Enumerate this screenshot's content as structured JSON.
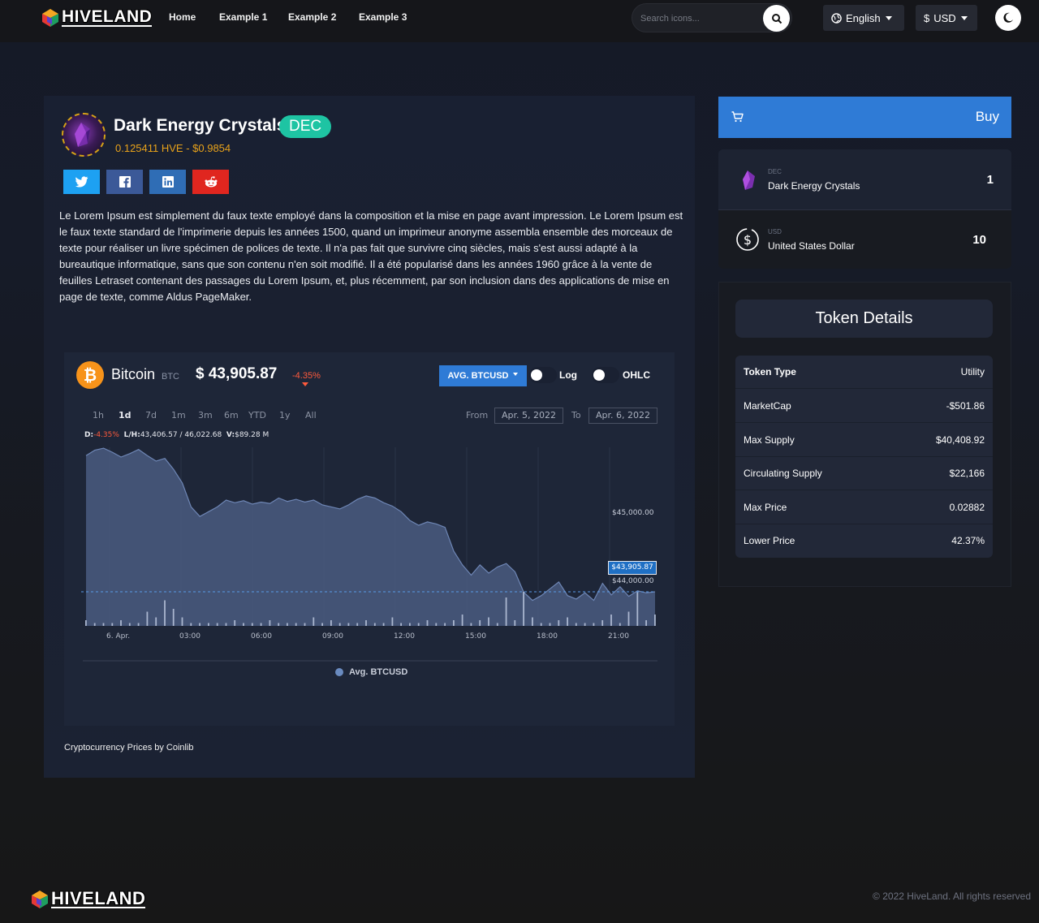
{
  "brand": {
    "name": "HIVELAND"
  },
  "nav": {
    "links": [
      "Home",
      "Example 1",
      "Example 2",
      "Example 3"
    ],
    "search_placeholder": "Search icons...",
    "language": "English",
    "currency_symbol": "$",
    "currency": "USD"
  },
  "token": {
    "name": "Dark Energy Crystals",
    "symbol": "DEC",
    "price_line": "0.125411 HVE - $0.9854",
    "description": "Le Lorem Ipsum est simplement du faux texte employé dans la composition et la mise en page avant impression. Le Lorem Ipsum est le faux texte standard de l'imprimerie depuis les années 1500, quand un imprimeur anonyme assembla ensemble des morceaux de texte pour réaliser un livre spécimen de polices de texte. Il n'a pas fait que survivre cinq siècles, mais s'est aussi adapté à la bureautique informatique, sans que son contenu n'en soit modifié. Il a été popularisé dans les années 1960 grâce à la vente de feuilles Letraset contenant des passages du Lorem Ipsum, et, plus récemment, par son inclusion dans des applications de mise en page de texte, comme Aldus PageMaker."
  },
  "share": [
    "twitter",
    "facebook",
    "linkedin",
    "reddit"
  ],
  "widget": {
    "coin_name": "Bitcoin",
    "coin_symbol": "BTC",
    "price": "$ 43,905.87",
    "change": "-4.35%",
    "series_button": "AVG. BTCUSD",
    "toggle_log": "Log",
    "toggle_ohlc": "OHLC",
    "ranges": [
      "1h",
      "1d",
      "7d",
      "1m",
      "3m",
      "6m",
      "YTD",
      "1y",
      "All"
    ],
    "active_range": "1d",
    "from_label": "From",
    "from_date": "Apr. 5, 2022",
    "to_label": "To",
    "to_date": "Apr. 6, 2022",
    "stats": {
      "d_label": "D:",
      "d_value": "-4.35%",
      "lh_label": "L/H:",
      "lh_value": "43,406.57 / 46,022.68",
      "v_label": "V:",
      "v_value": "$89.28 M"
    },
    "credit": "Cryptocurrency Prices by Coinlib"
  },
  "chart_data": {
    "type": "area",
    "title": "",
    "xlabel": "",
    "ylabel": "",
    "x_ticks": [
      "6. Apr.",
      "03:00",
      "06:00",
      "09:00",
      "12:00",
      "15:00",
      "18:00",
      "21:00"
    ],
    "y_ticks": [
      "$45,000.00",
      "$44,000.00"
    ],
    "ylim": [
      43406.57,
      46022.68
    ],
    "current_value_label": "$43,905.87",
    "current_value": 43905.87,
    "legend": [
      "Avg. BTCUSD"
    ],
    "series": [
      {
        "name": "Avg. BTCUSD",
        "values": [
          45900,
          45980,
          46010,
          45950,
          45880,
          45930,
          45990,
          45900,
          45820,
          45860,
          45700,
          45500,
          45150,
          45010,
          45080,
          45150,
          45250,
          45210,
          45240,
          45190,
          45220,
          45200,
          45280,
          45230,
          45260,
          45220,
          45250,
          45180,
          45150,
          45120,
          45180,
          45260,
          45310,
          45280,
          45210,
          45160,
          45080,
          44950,
          44880,
          44930,
          44900,
          44850,
          44500,
          44300,
          44150,
          44300,
          44180,
          44270,
          44320,
          44200,
          43900,
          43780,
          43850,
          43950,
          44050,
          43850,
          43800,
          43890,
          43780,
          44030,
          43860,
          43980,
          43840,
          43920,
          43890,
          43905.87
        ]
      }
    ],
    "volume": [
      2,
      1,
      1,
      1,
      2,
      1,
      1,
      5,
      3,
      9,
      6,
      3,
      1,
      1,
      1,
      1,
      1,
      2,
      1,
      1,
      1,
      2,
      1,
      1,
      1,
      1,
      3,
      1,
      2,
      1,
      1,
      1,
      2,
      1,
      1,
      3,
      1,
      1,
      1,
      2,
      1,
      1,
      2,
      4,
      1,
      2,
      3,
      1,
      10,
      2,
      12,
      3,
      1,
      1,
      2,
      3,
      1,
      1,
      1,
      2,
      4,
      1,
      5,
      12,
      2,
      4
    ]
  },
  "buy": {
    "label": "Buy"
  },
  "swap": [
    {
      "symbol": "DEC",
      "name": "Dark Energy Crystals",
      "amount": "1"
    },
    {
      "symbol": "USD",
      "name": "United States Dollar",
      "amount": "10"
    }
  ],
  "details": {
    "title": "Token Details",
    "rows": [
      {
        "key": "Token Type",
        "value": "Utility"
      },
      {
        "key": "MarketCap",
        "value": "-$501.86"
      },
      {
        "key": "Max Supply",
        "value": "$40,408.92"
      },
      {
        "key": "Circulating Supply",
        "value": "$22,166"
      },
      {
        "key": "Max Price",
        "value": "0.02882"
      },
      {
        "key": "Lower Price",
        "value": "42.37%"
      }
    ]
  },
  "footer": {
    "copyright": "© 2022 HiveLand. All rights reserved"
  },
  "colors": {
    "accent_blue": "#2f7bd6",
    "badge_teal": "#1ec4a3",
    "price_orange": "#e8a21a",
    "negative": "#ff5a3c",
    "bitcoin": "#f7931a",
    "twitter": "#1da1f2",
    "facebook": "#3b5998",
    "linkedin": "#2f6db5",
    "reddit": "#e0261f"
  }
}
